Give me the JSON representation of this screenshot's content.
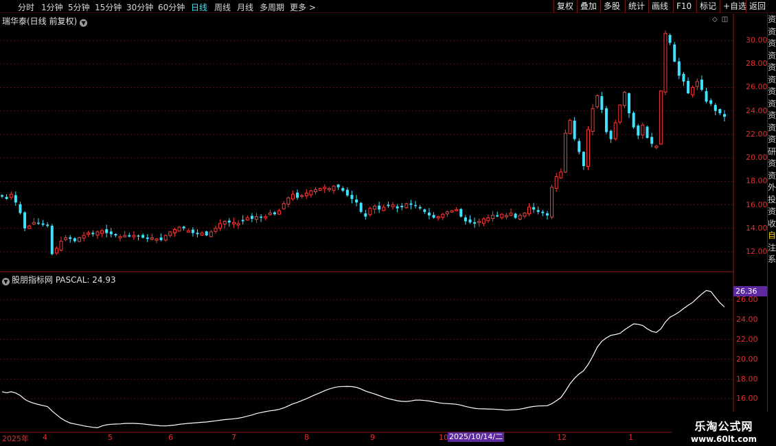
{
  "toolbar": {
    "periods": [
      "分时",
      "1分钟",
      "5分钟",
      "15分钟",
      "30分钟",
      "60分钟",
      "日线",
      "周线",
      "月线",
      "多周期",
      "更多 >"
    ],
    "active_period": "日线",
    "right_buttons": [
      "复权",
      "叠加",
      "多股",
      "统计",
      "画线",
      "F10",
      "标记",
      "+自选",
      "返回"
    ]
  },
  "chart": {
    "title": "瑞华泰(日线 前复权)",
    "price_ticks": [
      "30.00",
      "28.00",
      "26.00",
      "24.00",
      "22.00",
      "20.00",
      "18.00",
      "16.00",
      "14.00",
      "12.00"
    ]
  },
  "indicator": {
    "title": "股朋指标网 PASCAL: 24.93",
    "current_value": "26.36",
    "ticks": [
      "26.00",
      "24.00",
      "22.00",
      "20.00",
      "18.00",
      "16.00"
    ]
  },
  "date_axis": {
    "labels": [
      "2025年",
      "4",
      "5",
      "6",
      "7",
      "8",
      "9",
      "10",
      "12",
      "1"
    ],
    "highlight": "2025/10/14/二"
  },
  "side_strip": [
    "资",
    "资",
    "资",
    "资",
    "资",
    "资",
    "资",
    "资",
    "资",
    "资",
    "资",
    "研",
    "资",
    "资",
    "外",
    "投",
    "资",
    "收",
    "",
    "",
    "自",
    "注",
    "系",
    "",
    "",
    "",
    "",
    "",
    "",
    ""
  ],
  "watermark": {
    "title": "乐淘公式网",
    "url": "www.60lt.com"
  },
  "colors": {
    "up": "#ff3838",
    "down": "#3fe3ff",
    "line": "#ffffff",
    "grid": "#5a0f0f",
    "axis": "#e03030"
  },
  "chart_data": {
    "type": "candlestick",
    "y_range": [
      11.0,
      31.5
    ],
    "indicator_range": [
      15.0,
      27.5
    ],
    "closes": [
      16.7,
      16.5,
      16.9,
      16.2,
      15.3,
      14.0,
      14.2,
      14.5,
      14.4,
      14.3,
      14.2,
      11.8,
      12.3,
      12.9,
      13.2,
      13.1,
      12.9,
      13.2,
      13.4,
      13.6,
      13.5,
      13.7,
      13.8,
      13.6,
      13.5,
      13.4,
      13.3,
      13.4,
      13.3,
      13.4,
      13.3,
      13.2,
      13.1,
      13.2,
      13.1,
      13.0,
      13.4,
      13.7,
      13.9,
      14.1,
      14.0,
      13.8,
      13.6,
      13.5,
      13.6,
      13.4,
      13.7,
      14.0,
      14.4,
      14.6,
      14.5,
      14.5,
      14.4,
      14.6,
      14.9,
      14.8,
      15.0,
      14.9,
      15.0,
      15.3,
      15.2,
      15.5,
      16.1,
      16.6,
      16.9,
      16.6,
      16.8,
      17.0,
      17.2,
      17.3,
      17.4,
      17.5,
      17.4,
      17.6,
      17.5,
      17.2,
      16.8,
      16.5,
      16.2,
      15.4,
      15.0,
      15.7,
      15.9,
      15.6,
      15.8,
      15.9,
      16.0,
      15.7,
      15.8,
      16.1,
      16.0,
      15.9,
      15.7,
      15.4,
      15.1,
      14.9,
      15.0,
      15.2,
      15.4,
      15.5,
      15.6,
      15.0,
      14.6,
      14.5,
      14.4,
      14.6,
      14.8,
      14.9,
      15.1,
      15.0,
      15.2,
      15.1,
      15.3,
      14.9,
      15.1,
      15.3,
      15.8,
      15.6,
      15.4,
      15.3,
      15.1,
      17.5,
      18.4,
      18.8,
      22.1,
      23.2,
      21.6,
      20.5,
      19.3,
      22.4,
      24.2,
      25.3,
      24.1,
      22.2,
      21.6,
      23.0,
      24.5,
      25.6,
      23.8,
      22.6,
      21.9,
      22.8,
      21.7,
      21.2,
      21.0,
      25.7,
      30.6,
      29.8,
      28.2,
      27.0,
      26.5,
      25.5,
      26.0,
      26.5,
      25.8,
      24.8,
      24.6,
      24.0,
      23.8,
      23.5
    ]
  }
}
